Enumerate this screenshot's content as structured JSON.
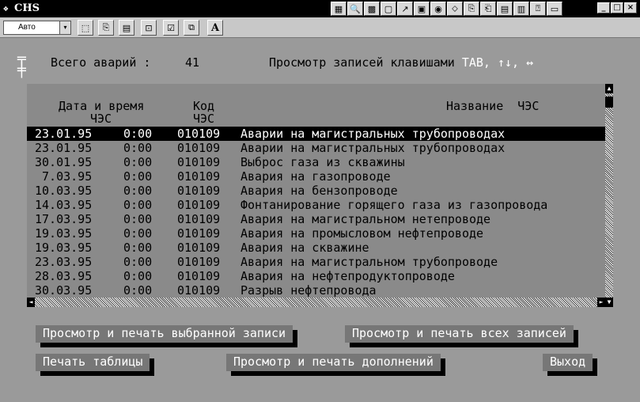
{
  "window": {
    "title": "CHS",
    "app_icon": "app-icon",
    "toolbar_icons": [
      "▦",
      "🔍",
      "▩",
      "▢",
      "↗",
      "▣",
      "◉",
      "⬦",
      "⎘",
      "⎗",
      "▤",
      "▥",
      "⍰",
      "▭"
    ],
    "controls": {
      "minimize": "_",
      "maximize": "□",
      "close": "×"
    }
  },
  "toolbar": {
    "font_size_value": "Авто",
    "dropdown_icon": "▾",
    "tools": [
      {
        "name": "mark-icon",
        "glyph": "⬚"
      },
      {
        "name": "copy-icon",
        "glyph": "⎘"
      },
      {
        "name": "paste-icon",
        "glyph": "▤"
      },
      {
        "name": "fullscreen-icon",
        "glyph": "⊡"
      },
      {
        "name": "properties-icon",
        "glyph": "☑"
      },
      {
        "name": "background-icon",
        "glyph": "⧉"
      },
      {
        "name": "font-icon",
        "glyph": "A"
      }
    ]
  },
  "info": {
    "total_label": "Всего аварий :",
    "total_value": "41",
    "hint_prefix": "Просмотр записей клавишами",
    "hint_keys": "TAB, ↑↓, ↔"
  },
  "table": {
    "headers": {
      "date_time": "Дата и время",
      "date_time_sub": "ЧЭС",
      "code": "Код",
      "code_sub": "ЧЭС",
      "name": "Название  ЧЭС"
    },
    "rows": [
      {
        "date": "23.01.95",
        "time": "0:00",
        "code": "010109",
        "name": "Аварии на магистральных трубопроводах",
        "selected": true
      },
      {
        "date": "23.01.95",
        "time": "0:00",
        "code": "010109",
        "name": "Аварии на магистральных трубопроводах"
      },
      {
        "date": "30.01.95",
        "time": "0:00",
        "code": "010109",
        "name": "Выброс газа из скважины"
      },
      {
        "date": " 7.03.95",
        "time": "0:00",
        "code": "010109",
        "name": "Авария на газопроводе"
      },
      {
        "date": "10.03.95",
        "time": "0:00",
        "code": "010109",
        "name": "Авария на бензопроводе"
      },
      {
        "date": "14.03.95",
        "time": "0:00",
        "code": "010109",
        "name": "Фонтанирование горящего газа из газопровода"
      },
      {
        "date": "17.03.95",
        "time": "0:00",
        "code": "010109",
        "name": "Авария на магистральном нетепроводе"
      },
      {
        "date": "19.03.95",
        "time": "0:00",
        "code": "010109",
        "name": "Авария на промысловом нефтепроводе"
      },
      {
        "date": "19.03.95",
        "time": "0:00",
        "code": "010109",
        "name": "Авария на скважине"
      },
      {
        "date": "23.03.95",
        "time": "0:00",
        "code": "010109",
        "name": "Авария на магистральном трубопроводе"
      },
      {
        "date": "28.03.95",
        "time": "0:00",
        "code": "010109",
        "name": "Авария на нефтепродуктопроводе"
      },
      {
        "date": "30.03.95",
        "time": "0:00",
        "code": "010109",
        "name": "Разрыв нефтепровода"
      }
    ]
  },
  "scrollbar": {
    "up": "▲",
    "down": "▼",
    "left": "◄",
    "right": "►"
  },
  "buttons": {
    "view_print_selected": "Просмотр и печать выбранной записи",
    "view_print_all": "Просмотр и печать всех записей",
    "print_table": "Печать таблицы",
    "view_print_additions": "Просмотр и печать дополнений",
    "exit": "Выход"
  }
}
